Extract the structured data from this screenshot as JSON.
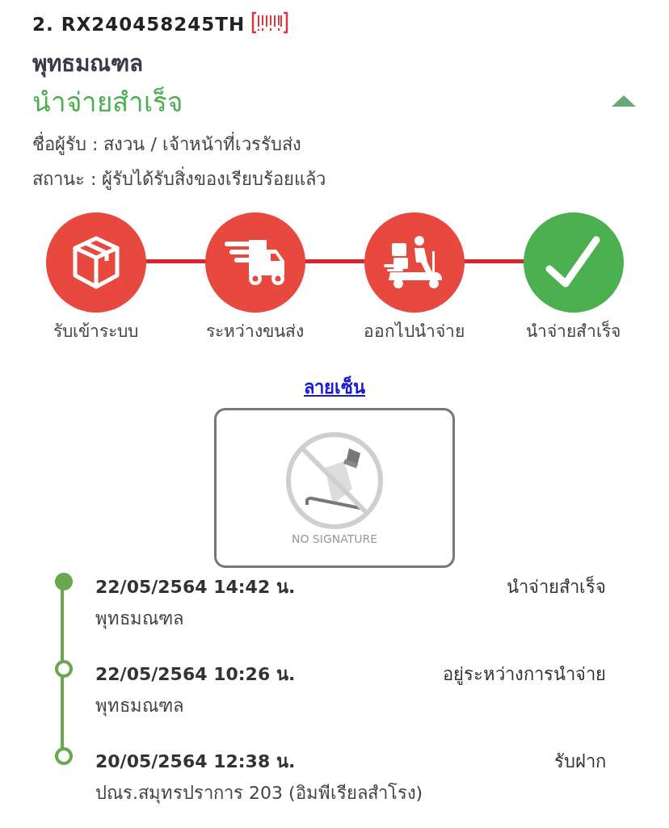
{
  "parcel": {
    "number": "2. RX240458245TH",
    "office": "พุทธมณฑล",
    "status": "นำจ่ายสำเร็จ",
    "expanded": true,
    "recipient": "ชื่อผู้รับ : สงวน / เจ้าหน้าที่เวรรับส่ง",
    "state": "สถานะ : ผู้รับได้รับสิ่งของเรียบร้อยแล้ว"
  },
  "steps": [
    {
      "kind": "box",
      "label": "รับเข้าระบบ",
      "color": "#e8493e"
    },
    {
      "kind": "truck",
      "label": "ระหว่างขนส่ง",
      "color": "#e8493e"
    },
    {
      "kind": "scooter",
      "label": "ออกไปนำจ่าย",
      "color": "#e8493e"
    },
    {
      "kind": "check",
      "label": "นำจ่ายสำเร็จ",
      "color": "#4caf50"
    }
  ],
  "signature": {
    "link": "ลายเซ็น",
    "placeholder_text": "NO SIGNATURE"
  },
  "timeline": [
    {
      "time": "22/05/2564 14:42 น.",
      "event": "นำจ่ายสำเร็จ",
      "place": "พุทธมณฑล",
      "selected": true
    },
    {
      "time": "22/05/2564 10:26 น.",
      "event": "อยู่ระหว่างการนำจ่าย",
      "place": "พุทธมณฑล",
      "selected": false
    },
    {
      "time": "20/05/2564 12:38 น.",
      "event": "รับฝาก",
      "place": "ปณร.สมุทรปราการ 203 (อิมพีเรียลสำโรง)",
      "selected": false
    }
  ]
}
